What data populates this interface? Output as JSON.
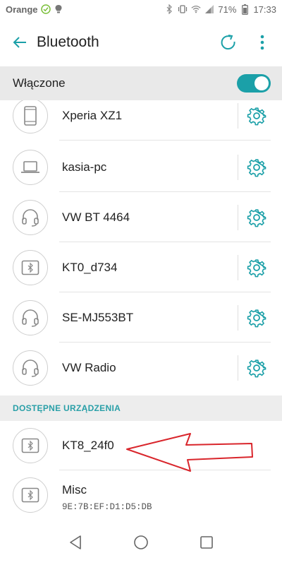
{
  "status_bar": {
    "carrier": "Orange",
    "battery": "71%",
    "time": "17:33"
  },
  "app_bar": {
    "title": "Bluetooth",
    "icons": [
      "back-arrow-icon",
      "refresh-icon",
      "more-vert-icon"
    ]
  },
  "toggle": {
    "label": "Włączone",
    "on": true
  },
  "paired_devices": [
    {
      "name": "Xperia XZ1",
      "icon": "phone-icon"
    },
    {
      "name": "kasia-pc",
      "icon": "laptop-icon"
    },
    {
      "name": "VW BT 4464",
      "icon": "headset-icon"
    },
    {
      "name": "KT0_d734",
      "icon": "bluetooth-device-icon"
    },
    {
      "name": "SE-MJ553BT",
      "icon": "headset-icon"
    },
    {
      "name": "VW Radio",
      "icon": "headset-icon"
    }
  ],
  "available_section": {
    "title": "DOSTĘPNE URZĄDZENIA",
    "devices": [
      {
        "name": "KT8_24f0",
        "icon": "bluetooth-device-icon"
      },
      {
        "name": "Misc",
        "address": "9E:7B:EF:D1:D5:DB",
        "icon": "bluetooth-device-icon"
      }
    ]
  },
  "colors": {
    "accent": "#1ba0a8",
    "section_bg": "#ededed",
    "annotation_arrow": "#d9262c"
  }
}
